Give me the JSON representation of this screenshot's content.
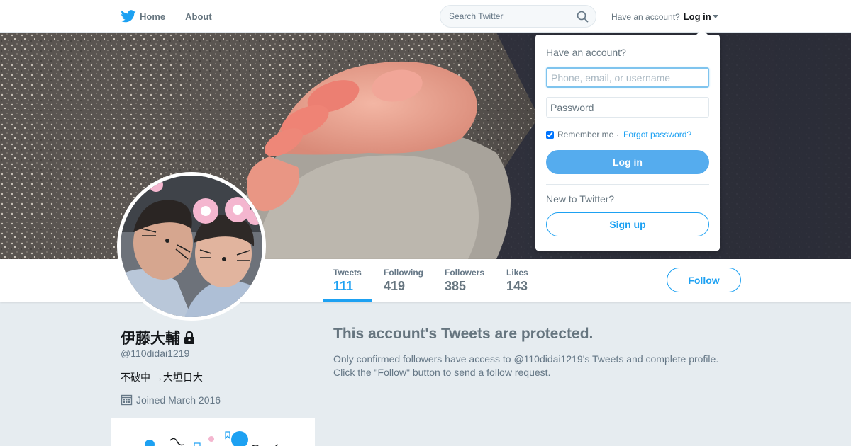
{
  "nav": {
    "home_label": "Home",
    "about_label": "About",
    "search_placeholder": "Search Twitter",
    "have_account": "Have an account?",
    "login_label": "Log in"
  },
  "profile_nav": {
    "stats": [
      {
        "label": "Tweets",
        "value": "111"
      },
      {
        "label": "Following",
        "value": "419"
      },
      {
        "label": "Followers",
        "value": "385"
      },
      {
        "label": "Likes",
        "value": "143"
      }
    ],
    "follow_label": "Follow"
  },
  "profile": {
    "name": "伊藤大輔",
    "handle": "@110didai1219",
    "bio": "不破中 →大垣日大",
    "joined": "Joined March 2016"
  },
  "protected": {
    "title": "This account's Tweets are protected.",
    "line1": "Only confirmed followers have access to @110didai1219's Tweets and complete profile.",
    "line2": "Click the \"Follow\" button to send a follow request."
  },
  "login_dropdown": {
    "heading": "Have an account?",
    "username_placeholder": "Phone, email, or username",
    "password_placeholder": "Password",
    "remember_label": "Remember me",
    "separator": " · ",
    "forgot_label": "Forgot password?",
    "login_button": "Log in",
    "new_to_twitter": "New to Twitter?",
    "signup_button": "Sign up"
  },
  "colors": {
    "accent": "#1da1f2",
    "login_button_bg": "#55acee",
    "page_bg": "#e6ecf0"
  },
  "icons": [
    "twitter-bird-icon",
    "search-icon",
    "chevron-down-icon",
    "lock-icon",
    "calendar-icon"
  ]
}
